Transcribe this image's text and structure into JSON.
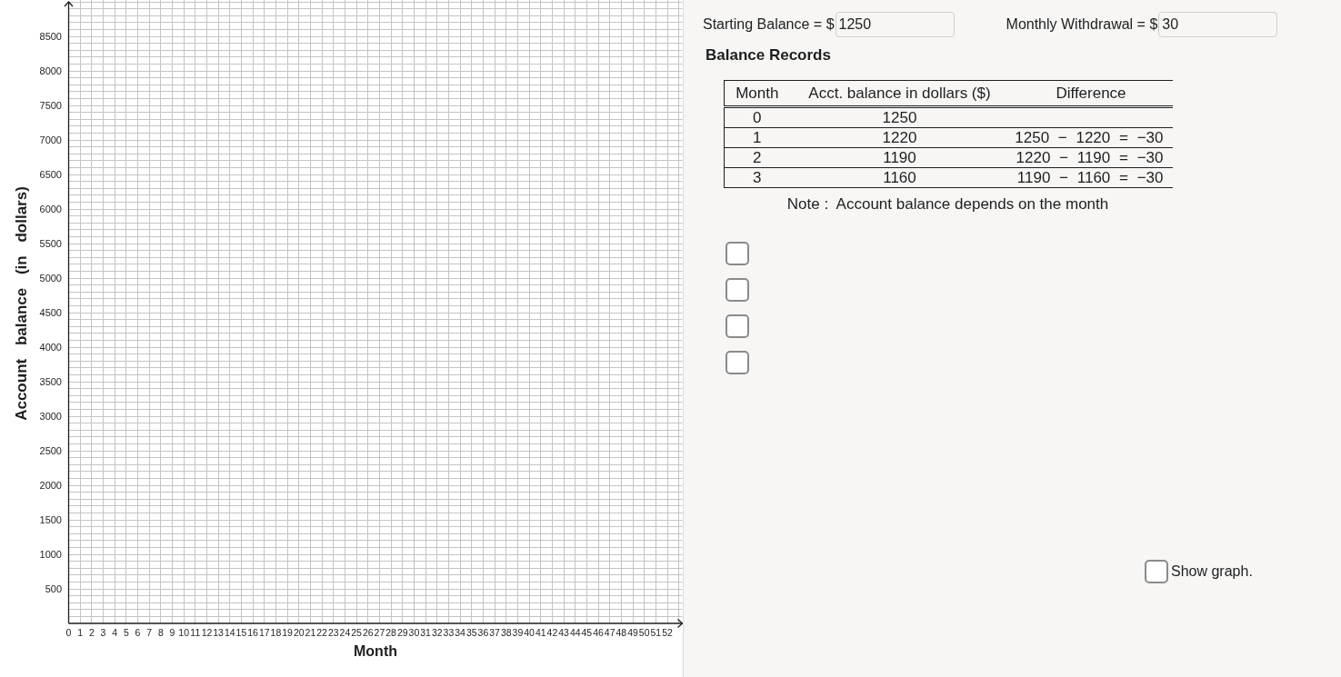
{
  "graph": {
    "chart_data": {
      "type": "line",
      "xlabel": "Month",
      "ylabel": "Account balance (in dollars)",
      "xlim": [
        0,
        53.3
      ],
      "ylim": [
        0,
        9000
      ],
      "xticks": [
        0,
        1,
        2,
        3,
        4,
        5,
        6,
        7,
        8,
        9,
        10,
        11,
        12,
        13,
        14,
        15,
        16,
        17,
        18,
        19,
        20,
        21,
        22,
        23,
        24,
        25,
        26,
        27,
        28,
        29,
        30,
        31,
        32,
        33,
        34,
        35,
        36,
        37,
        38,
        39,
        40,
        41,
        42,
        43,
        44,
        45,
        46,
        47,
        48,
        49,
        50,
        51,
        52
      ],
      "yticks": [
        500,
        1000,
        1500,
        2000,
        2500,
        3000,
        3500,
        4000,
        4500,
        5000,
        5500,
        6000,
        6500,
        7000,
        7500,
        8000,
        8500
      ],
      "grid": true
    }
  },
  "inputs": [
    {
      "label": "Starting Balance = $",
      "value": "1250"
    },
    {
      "label": "Monthly Withdrawal = $",
      "value": "30"
    }
  ],
  "records": {
    "title": "Balance Records",
    "columns": [
      "Month",
      "Acct. balance in dollars ($)",
      "Difference"
    ],
    "rows": [
      {
        "month": "0",
        "balance": "1250"
      },
      {
        "month": "1",
        "balance": "1220",
        "difference": "1250 − 1220 = −30"
      },
      {
        "month": "2",
        "balance": "1190",
        "difference": "1220 − 1190 = −30"
      },
      {
        "month": "3",
        "balance": "1160",
        "difference": "1190 − 1160 = −30"
      }
    ],
    "note": "Note :  Account balance depends on the month"
  },
  "checkboxes": [
    {
      "checked": false
    },
    {
      "checked": false
    },
    {
      "checked": false
    },
    {
      "checked": false
    }
  ],
  "show_graph": {
    "label": "Show graph.",
    "checked": false
  }
}
